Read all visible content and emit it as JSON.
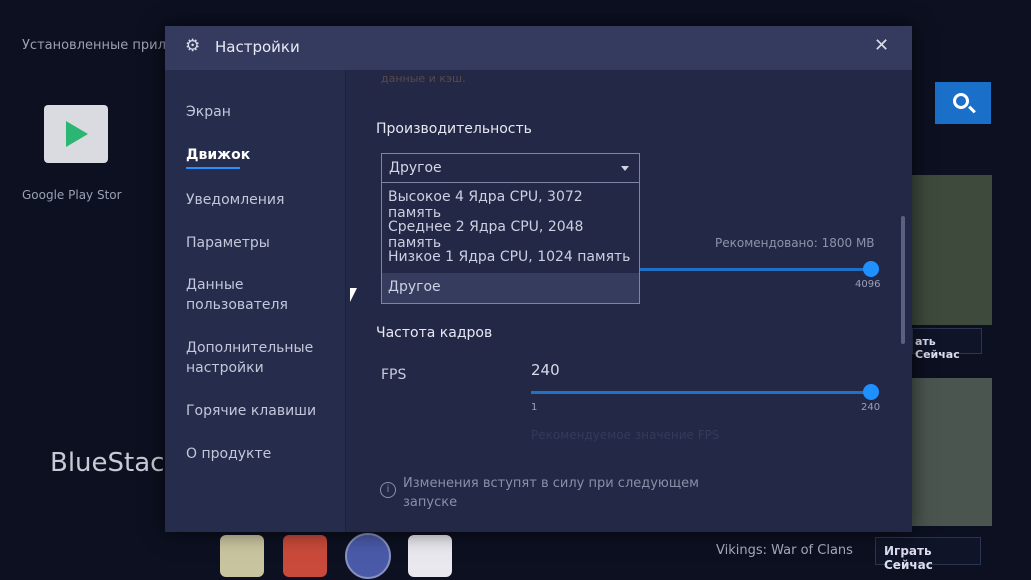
{
  "background": {
    "installed_label": "Установленные прило",
    "app_name": "Google Play Stor",
    "brand": "BlueStack",
    "game_title": "Vikings: War of Clans",
    "play_button": "Играть Сейчас",
    "play_button_partial": "ать Сейчас"
  },
  "dialog": {
    "title": "Настройки",
    "close": "✕"
  },
  "sidebar": {
    "items": [
      {
        "label": "Экран"
      },
      {
        "label": "Движок"
      },
      {
        "label": "Уведомления"
      },
      {
        "label": "Параметры"
      },
      {
        "label": "Данные пользователя"
      },
      {
        "label": "Дополнительные настройки"
      },
      {
        "label": "Горячие клавиши"
      },
      {
        "label": "О продукте"
      }
    ],
    "active": "Движок"
  },
  "content": {
    "faded_top": "данные и кэш.",
    "performance": {
      "heading": "Производительность",
      "selected": "Другое",
      "options": [
        "Высокое 4 Ядра CPU, 3072 память",
        "Среднее 2 Ядра CPU, 2048 память",
        "Низкое 1 Ядра CPU, 1024 память",
        "Другое"
      ]
    },
    "memory": {
      "recommended": "Рекомендовано: 1800 MB",
      "max_label": "4096",
      "value_fraction": 1.0
    },
    "fps": {
      "heading": "Частота кадров",
      "label": "FPS",
      "value": "240",
      "min": "1",
      "max": "240",
      "value_fraction": 1.0,
      "recommended": "Рекомендуемое значение FPS"
    },
    "notice": "Изменения вступят в силу при следующем запуске"
  },
  "colors": {
    "accent": "#1e90ff",
    "dialog_bg": "#222845",
    "header_bg": "#353b5f"
  }
}
